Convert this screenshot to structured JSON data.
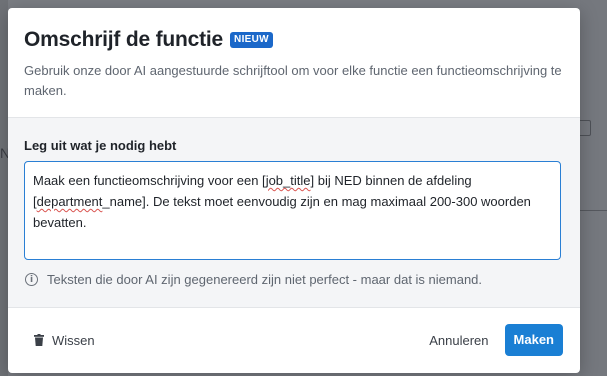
{
  "dialog": {
    "title": "Omschrijf de functie",
    "badge": "NIEUW",
    "subtitle": "Gebruik onze door AI aangestuurde schrijftool om voor elke functie een functieomschrijving te maken."
  },
  "prompt": {
    "label": "Leg uit wat je nodig hebt",
    "value_part1": "Maak een functieomschrijving voor een [",
    "value_spell1": "job_title",
    "value_part2": "] bij NED binnen de afdeling\n[",
    "value_spell2": "department",
    "value_part3": "_name]. De tekst moet eenvoudig zijn en mag maximaal 200-300 woorden bevatten.",
    "hint": "Teksten die door AI zijn gegenereerd zijn niet perfect - maar dat is niemand."
  },
  "footer": {
    "clear_label": "Wissen",
    "cancel_label": "Annuleren",
    "submit_label": "Maken"
  },
  "background": {
    "letter": "N"
  },
  "colors": {
    "accent": "#1a7fd4",
    "badge": "#1b68c9"
  }
}
